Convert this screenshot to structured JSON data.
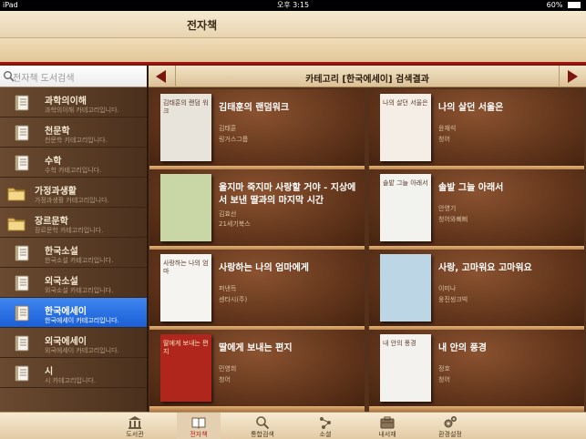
{
  "status": {
    "device": "iPad",
    "time": "오후 3:15",
    "battery": "60%"
  },
  "header": {
    "title": "전자책"
  },
  "search": {
    "placeholder": "전자책 도서검색"
  },
  "categories": [
    {
      "name": "과학의이해",
      "desc": "과학의이해 카테고리입니다.",
      "icon": "book-icon"
    },
    {
      "name": "천문학",
      "desc": "천문학 카테고리입니다.",
      "icon": "book-icon"
    },
    {
      "name": "수학",
      "desc": "수학 카테고리입니다.",
      "icon": "book-icon"
    },
    {
      "name": "가정과생활",
      "desc": "가정과생활 카테고리입니다.",
      "icon": "folder-icon"
    },
    {
      "name": "장르문학",
      "desc": "장르문학 카테고리입니다.",
      "icon": "folder-open-icon"
    },
    {
      "name": "한국소설",
      "desc": "한국소설 카테고리입니다.",
      "icon": "book-icon"
    },
    {
      "name": "외국소설",
      "desc": "외국소설 카테고리입니다.",
      "icon": "book-icon"
    },
    {
      "name": "한국에세이",
      "desc": "한국에세이 카테고리입니다.",
      "icon": "book-icon",
      "selected": true
    },
    {
      "name": "외국에세이",
      "desc": "외국에세이 카테고리입니다.",
      "icon": "book-icon"
    },
    {
      "name": "시",
      "desc": "시 카테고리입니다.",
      "icon": "book-icon"
    }
  ],
  "results": {
    "title": "카테고리 [한국에세이] 검색결과"
  },
  "books": [
    {
      "title": "김태훈의 랜덤워크",
      "author": "김태훈",
      "publisher": "링거스그룹",
      "cover_color": "#e8e4dc",
      "cover_text": "김태훈의 랜덤 워크"
    },
    {
      "title": "나의 살던 서울은",
      "author": "윤재석",
      "publisher": "청어",
      "cover_color": "#f4eee6",
      "cover_text": "나의 살던 서울은"
    },
    {
      "title": "울지마 죽지마 사랑할 거야 - 지상에서 보낸 딸과의 마지막 시간",
      "author": "김효선",
      "publisher": "21세기북스",
      "cover_color": "#c9d7a6",
      "cover_text": ""
    },
    {
      "title": "솔밭 그늘 아래서",
      "author": "안영기",
      "publisher": "청어와삐삐",
      "cover_color": "#f2f2ee",
      "cover_text": "솔밭 그늘 아래서"
    },
    {
      "title": "사랑하는 나의 엄마에게",
      "author": "퍼낸득",
      "publisher": "센타시(주)",
      "cover_color": "#f6f4f0",
      "cover_text": "사랑하는 나의 엄마"
    },
    {
      "title": "사랑, 고마워요 고마워요",
      "author": "이미나",
      "publisher": "웅진씽크빅",
      "cover_color": "#bcd6e6",
      "cover_text": ""
    },
    {
      "title": "딸에게 보내는 편지",
      "author": "민영희",
      "publisher": "청어",
      "cover_color": "#b0261c",
      "cover_text": "딸에게 보내는 편지"
    },
    {
      "title": "내 안의 풍경",
      "author": "정호",
      "publisher": "청어",
      "cover_color": "#f4f2ee",
      "cover_text": "내 안의 풍경"
    }
  ],
  "tabs": [
    {
      "label": "도서관",
      "icon": "library-icon"
    },
    {
      "label": "전자책",
      "icon": "ebook-icon",
      "selected": true
    },
    {
      "label": "통합검색",
      "icon": "search-icon"
    },
    {
      "label": "소셜",
      "icon": "social-icon"
    },
    {
      "label": "내서재",
      "icon": "bookshelf-icon"
    },
    {
      "label": "환경설정",
      "icon": "settings-icon"
    }
  ]
}
